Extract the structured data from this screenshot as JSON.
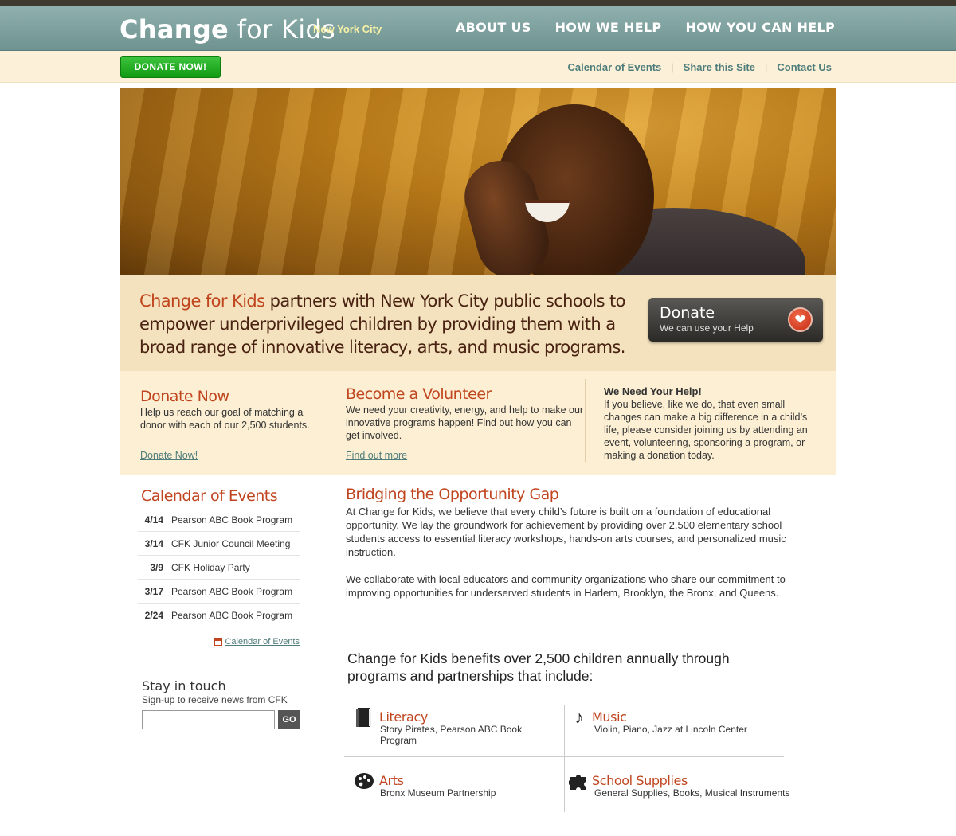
{
  "header": {
    "logo_change": "Change",
    "logo_for": "for Kids",
    "city": "New York City",
    "nav": [
      "ABOUT US",
      "HOW WE HELP",
      "HOW YOU CAN HELP"
    ]
  },
  "subbar": {
    "donate_label": "DONATE NOW!",
    "links": [
      "Calendar of Events",
      "Share this Site",
      "Contact Us"
    ]
  },
  "mission": {
    "brand": "Change for Kids",
    "text": " partners with New York City public schools to empower underprivileged children by providing them with a broad range of innovative literacy, arts, and music programs.",
    "donate_title": "Donate",
    "donate_sub": "We can use your Help"
  },
  "panels": {
    "donate": {
      "title": "Donate Now",
      "body": "Help us reach our goal of matching a donor with each of our 2,500 students.",
      "link": "Donate Now!"
    },
    "volunteer": {
      "title": "Become a Volunteer",
      "body": "We need your creativity, energy, and help to make our innovative programs happen! Find out how you can get involved.",
      "link": "Find out more"
    },
    "help": {
      "title": "We Need Your Help!",
      "body": "If you believe, like we do, that even small changes can make a big difference in a child’s life, please consider joining us by attending an event, volunteering, sponsoring a program, or making a donation today."
    }
  },
  "calendar": {
    "title": "Calendar of Events",
    "events": [
      {
        "date": "4/14",
        "name": "Pearson ABC Book Program"
      },
      {
        "date": "3/14",
        "name": "CFK Junior Council Meeting"
      },
      {
        "date": "3/9",
        "name": "CFK Holiday Party"
      },
      {
        "date": "3/17",
        "name": "Pearson ABC Book Program"
      },
      {
        "date": "2/24",
        "name": "Pearson ABC Book Program"
      }
    ],
    "more_link": "Calendar of Events"
  },
  "stay": {
    "title": "Stay in touch",
    "sub": "Sign-up to receive news from CFK",
    "input_value": "",
    "go": "GO"
  },
  "main": {
    "title": "Bridging the Opportunity Gap",
    "p1": "At Change for Kids, we believe that every child’s future is built on a foundation of educational opportunity. We lay the groundwork for achievement by providing over 2,500 elementary school students access to essential literacy workshops, hands-on arts courses, and personalized music instruction.",
    "p2": "We collaborate with local educators and community organizations who share our commitment to improving opportunities for underserved students in Harlem, Brooklyn, the Bronx, and Queens.",
    "benefits": "Change for Kids benefits over 2,500 children annually through programs and partnerships that include:"
  },
  "programs": [
    {
      "title": "Literacy",
      "body": "Story Pirates, Pearson ABC Book Program",
      "icon": "book-icon"
    },
    {
      "title": "Music",
      "body": "Violin, Piano, Jazz at Lincoln Center",
      "icon": "music-note-icon"
    },
    {
      "title": "Arts",
      "body": "Bronx Museum Partnership",
      "icon": "palette-icon"
    },
    {
      "title": "School Supplies",
      "body": "General Supplies, Books, Musical Instruments",
      "icon": "puzzle-icon"
    }
  ],
  "icons": {
    "heart": "heart-icon",
    "calendar": "calendar-icon"
  }
}
